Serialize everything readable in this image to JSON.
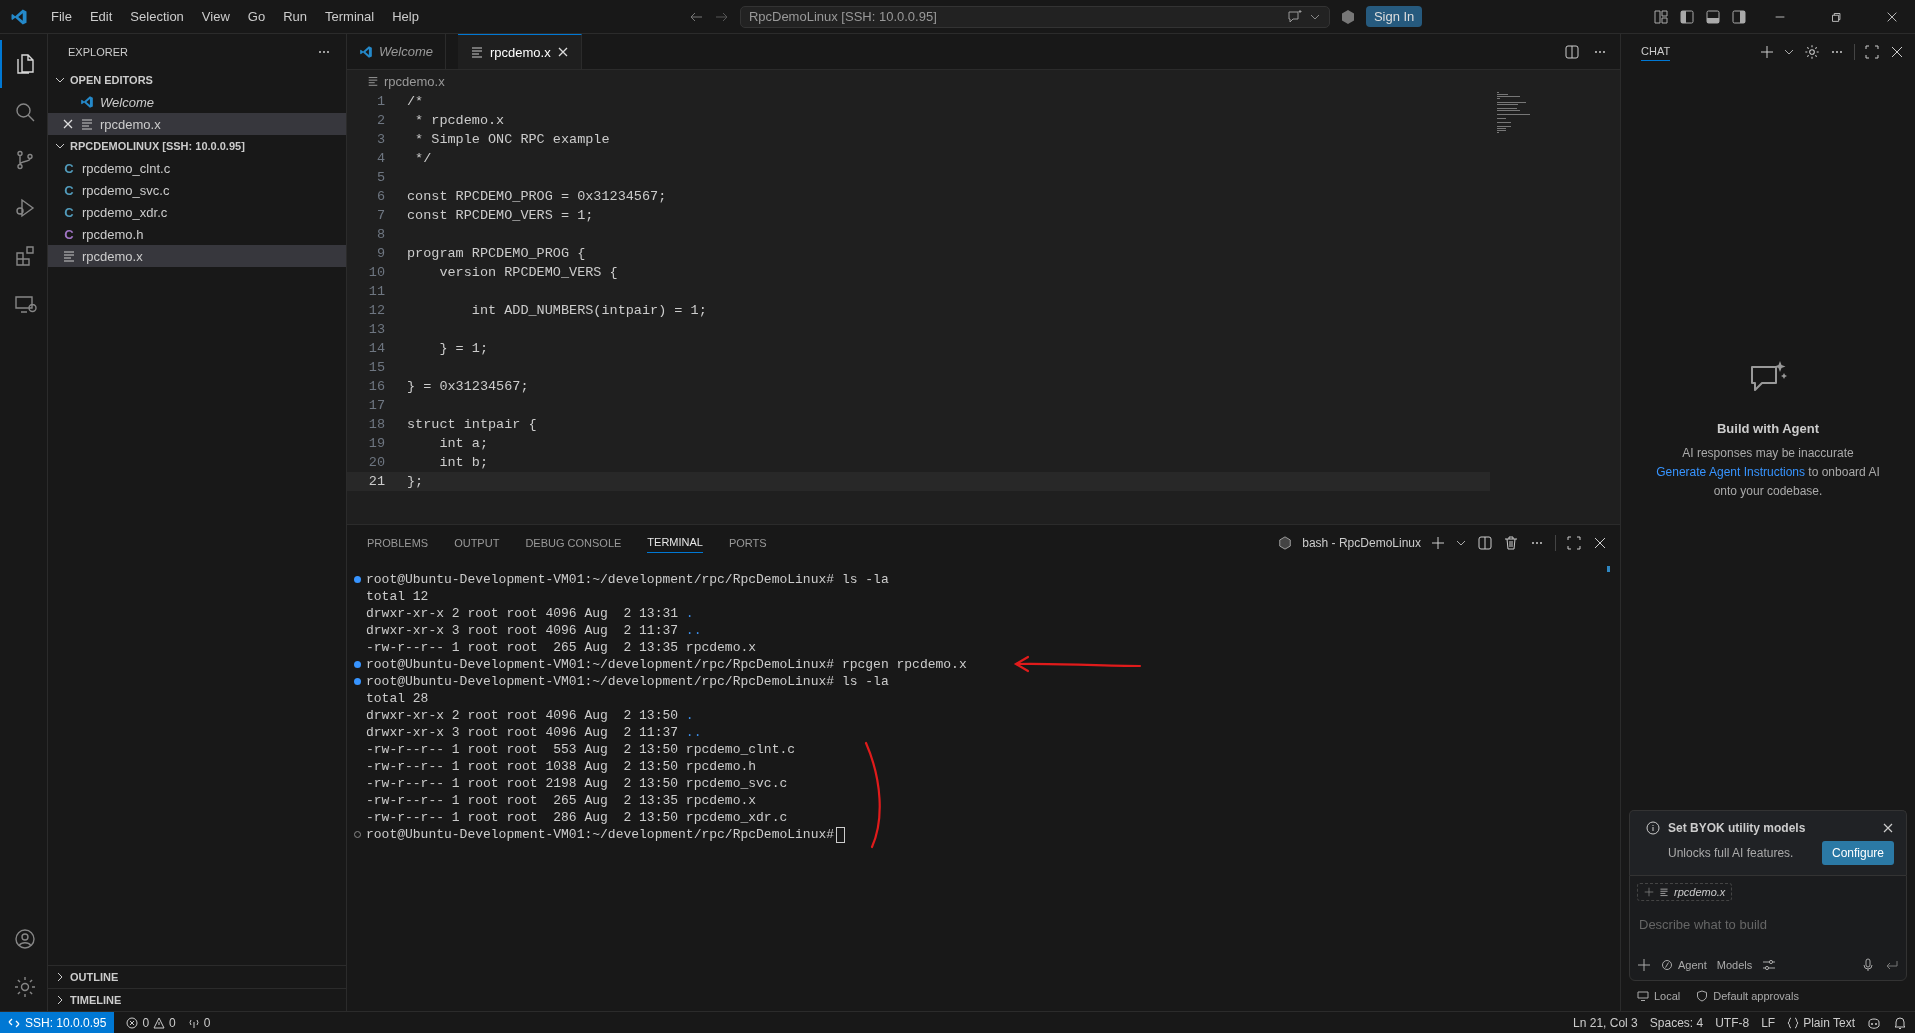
{
  "title_bar": {
    "menu": [
      "File",
      "Edit",
      "Selection",
      "View",
      "Go",
      "Run",
      "Terminal",
      "Help"
    ],
    "command_center": "RpcDemoLinux [SSH: 10.0.0.95]",
    "sign_in": "Sign In"
  },
  "activity_bar": [
    {
      "kind": "files",
      "selected": true
    },
    {
      "kind": "search",
      "selected": false
    },
    {
      "kind": "branch",
      "selected": false
    },
    {
      "kind": "debug",
      "selected": false
    },
    {
      "kind": "extensions",
      "selected": false
    },
    {
      "kind": "remote",
      "selected": false
    }
  ],
  "sidebar": {
    "title": "EXPLORER",
    "open_editors": {
      "label": "OPEN EDITORS",
      "expanded": true,
      "items": [
        {
          "name": "Welcome",
          "kind": "vscode",
          "preview": true,
          "selected": false
        },
        {
          "name": "rpcdemo.x",
          "kind": "text",
          "preview": false,
          "selected": true
        }
      ]
    },
    "folder": {
      "label": "RPCDEMOLINUX [SSH: 10.0.0.95]",
      "expanded": true,
      "items": [
        {
          "name": "rpcdemo_clnt.c",
          "kind": "c",
          "glyph": "C",
          "selected": false
        },
        {
          "name": "rpcdemo_svc.c",
          "kind": "c",
          "glyph": "C",
          "selected": false
        },
        {
          "name": "rpcdemo_xdr.c",
          "kind": "c",
          "glyph": "C",
          "selected": false
        },
        {
          "name": "rpcdemo.h",
          "kind": "h",
          "glyph": "C",
          "selected": false
        },
        {
          "name": "rpcdemo.x",
          "kind": "text",
          "selected": true
        }
      ]
    },
    "sections": [
      {
        "label": "OUTLINE",
        "expanded": false
      },
      {
        "label": "TIMELINE",
        "expanded": false
      }
    ]
  },
  "editor": {
    "tabs": [
      {
        "label": "Welcome",
        "kind": "vscode",
        "preview": true,
        "selected": false
      },
      {
        "label": "rpcdemo.x",
        "kind": "text",
        "preview": false,
        "selected": true
      }
    ],
    "breadcrumb": "rpcdemo.x",
    "lines": [
      {
        "number": "1",
        "text": "/*",
        "current": false
      },
      {
        "number": "2",
        "text": " * rpcdemo.x",
        "current": false
      },
      {
        "number": "3",
        "text": " * Simple ONC RPC example",
        "current": false
      },
      {
        "number": "4",
        "text": " */",
        "current": false
      },
      {
        "number": "5",
        "current": false
      },
      {
        "number": "6",
        "text": "const RPCDEMO_PROG = 0x31234567;",
        "current": false
      },
      {
        "number": "7",
        "text": "const RPCDEMO_VERS = 1;",
        "current": false
      },
      {
        "number": "8",
        "current": false
      },
      {
        "number": "9",
        "text": "program RPCDEMO_PROG {",
        "current": false
      },
      {
        "number": "10",
        "text": "    version RPCDEMO_VERS {",
        "current": false
      },
      {
        "number": "11",
        "current": false
      },
      {
        "number": "12",
        "text": "        int ADD_NUMBERS(intpair) = 1;",
        "current": false
      },
      {
        "number": "13",
        "current": false
      },
      {
        "number": "14",
        "text": "    } = 1;",
        "current": false
      },
      {
        "number": "15",
        "current": false
      },
      {
        "number": "16",
        "text": "} = 0x31234567;",
        "current": false
      },
      {
        "number": "17",
        "current": false
      },
      {
        "number": "18",
        "text": "struct intpair {",
        "current": false
      },
      {
        "number": "19",
        "text": "    int a;",
        "current": false
      },
      {
        "number": "20",
        "text": "    int b;",
        "current": false
      },
      {
        "number": "21",
        "text": "};",
        "current": true
      }
    ]
  },
  "panel": {
    "tabs": [
      {
        "label": "PROBLEMS",
        "selected": false
      },
      {
        "label": "OUTPUT",
        "selected": false
      },
      {
        "label": "DEBUG CONSOLE",
        "selected": false
      },
      {
        "label": "TERMINAL",
        "selected": true
      },
      {
        "label": "PORTS",
        "selected": false
      }
    ],
    "terminal_name": "bash - RpcDemoLinux",
    "lines": [
      {
        "kind": "prompt",
        "done": true,
        "prompt": "root@Ubuntu-Development-VM01:~/development/rpc/RpcDemoLinux#",
        "command": "ls -la"
      },
      {
        "kind": "output",
        "text": "total 12"
      },
      {
        "kind": "output",
        "text": "drwxr-xr-x 2 root root 4096 Aug  2 13:31",
        "file": ".",
        "dir": true
      },
      {
        "kind": "output",
        "text": "drwxr-xr-x 3 root root 4096 Aug  2 11:37",
        "file": "..",
        "dir": true
      },
      {
        "kind": "output",
        "text": "-rw-r--r-- 1 root root  265 Aug  2 13:35",
        "file": "rpcdemo.x",
        "dir": false
      },
      {
        "kind": "prompt",
        "done": true,
        "prompt": "root@Ubuntu-Development-VM01:~/development/rpc/RpcDemoLinux#",
        "command": "rpcgen rpcdemo.x"
      },
      {
        "kind": "prompt",
        "done": true,
        "prompt": "root@Ubuntu-Development-VM01:~/development/rpc/RpcDemoLinux#",
        "command": "ls -la"
      },
      {
        "kind": "output",
        "text": "total 28"
      },
      {
        "kind": "output",
        "text": "drwxr-xr-x 2 root root 4096 Aug  2 13:50",
        "file": ".",
        "dir": true
      },
      {
        "kind": "output",
        "text": "drwxr-xr-x 3 root root 4096 Aug  2 11:37",
        "file": "..",
        "dir": true
      },
      {
        "kind": "output",
        "text": "-rw-r--r-- 1 root root  553 Aug  2 13:50",
        "file": "rpcdemo_clnt.c",
        "dir": false
      },
      {
        "kind": "output",
        "text": "-rw-r--r-- 1 root root 1038 Aug  2 13:50",
        "file": "rpcdemo.h",
        "dir": false
      },
      {
        "kind": "output",
        "text": "-rw-r--r-- 1 root root 2198 Aug  2 13:50",
        "file": "rpcdemo_svc.c",
        "dir": false
      },
      {
        "kind": "output",
        "text": "-rw-r--r-- 1 root root  265 Aug  2 13:35",
        "file": "rpcdemo.x",
        "dir": false
      },
      {
        "kind": "output",
        "text": "-rw-r--r-- 1 root root  286 Aug  2 13:50",
        "file": "rpcdemo_xdr.c",
        "dir": false
      },
      {
        "kind": "prompt",
        "done": false,
        "prompt": "root@Ubuntu-Development-VM01:~/development/rpc/RpcDemoLinux#",
        "cursor": true
      }
    ]
  },
  "chat": {
    "title": "CHAT",
    "heading": "Build with Agent",
    "disclaimer": "AI responses may be inaccurate",
    "link": "Generate Agent Instructions",
    "link_rest": "to onboard AI onto your codebase.",
    "notice": {
      "title": "Set BYOK utility models",
      "text": "Unlocks full AI features.",
      "button": "Configure"
    },
    "attachment": "rpcdemo.x",
    "placeholder": "Describe what to build",
    "mode": "Agent",
    "models": "Models",
    "location": "Local",
    "approvals": "Default approvals"
  },
  "status_bar": {
    "remote": "SSH: 10.0.0.95",
    "errors": "0",
    "warnings": "0",
    "ports": "0",
    "position": "Ln 21, Col 3",
    "spaces": "Spaces: 4",
    "encoding": "UTF-8",
    "eol": "LF",
    "language": "Plain Text"
  }
}
